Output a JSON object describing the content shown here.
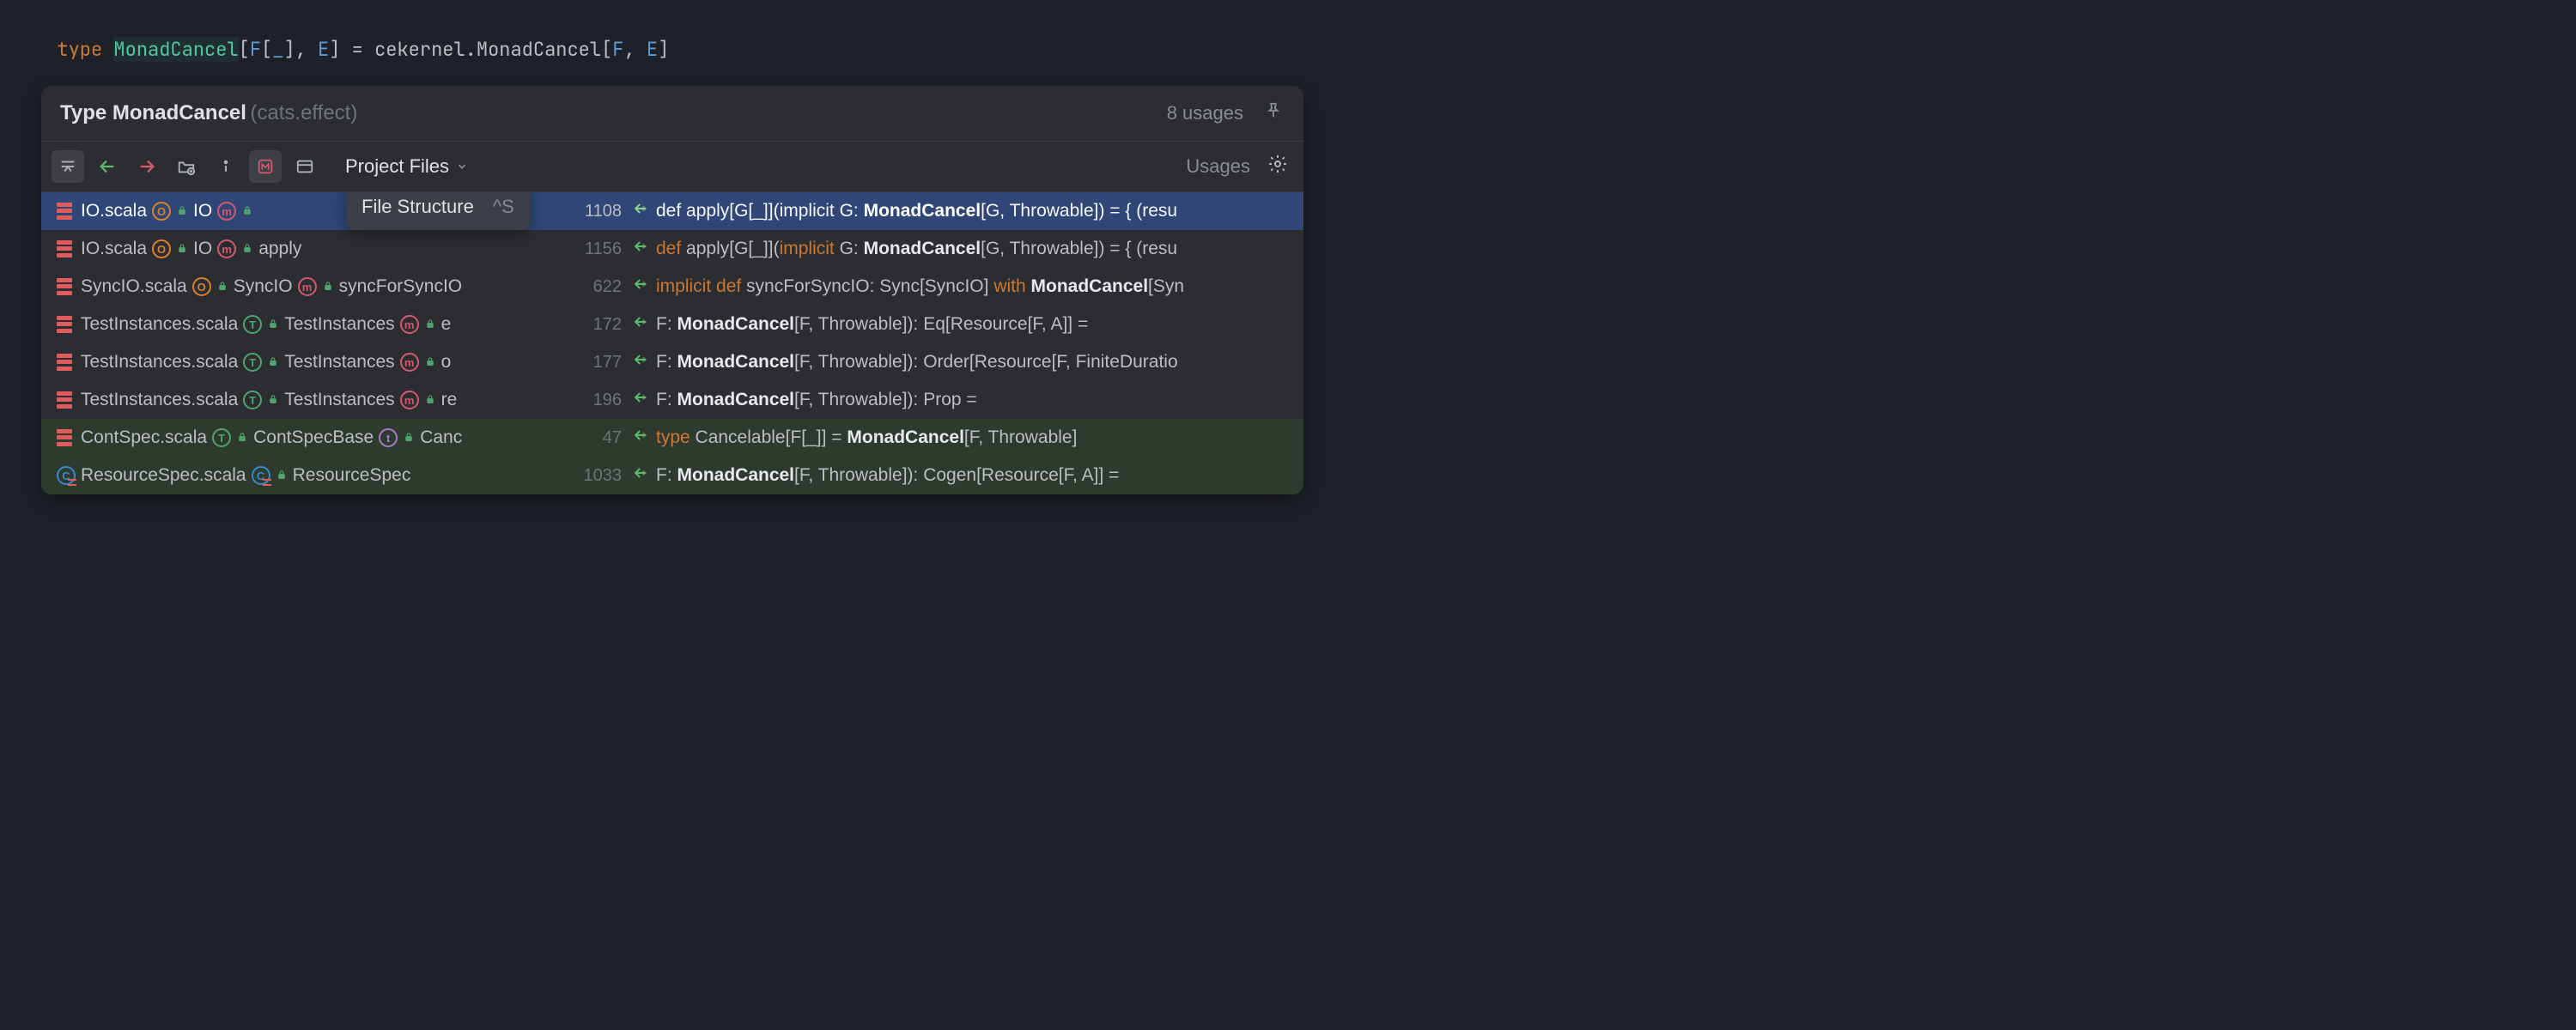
{
  "code": {
    "keyword": "type",
    "name": "MonadCancel",
    "sig_open": "[",
    "tp1": "F",
    "sig_mid1": "[",
    "tp_under": "_",
    "sig_mid2": "], ",
    "tp2": "E",
    "sig_close": "] = ",
    "rhs_pkg": "cekernel.MonadCancel[",
    "rhs_tp1": "F",
    "rhs_sep": ", ",
    "rhs_tp2": "E",
    "rhs_close": "]"
  },
  "popup": {
    "title": "Type MonadCancel",
    "subtitle": "(cats.effect)",
    "usages_count": "8 usages",
    "scope": "Project Files",
    "usages_label": "Usages",
    "tooltip": {
      "label": "File Structure",
      "shortcut": "^S"
    }
  },
  "rows": [
    {
      "file": "IO.scala",
      "badges": [
        {
          "kind": "ring",
          "letter": "O",
          "color": "#d9822b"
        },
        {
          "kind": "lock",
          "color": "#4fa36b"
        }
      ],
      "class": "IO",
      "badges2": [
        {
          "kind": "ring",
          "letter": "m",
          "color": "#d15a6f"
        },
        {
          "kind": "lock",
          "color": "#4fa36b"
        }
      ],
      "member": "",
      "line": "1108",
      "code_pre": "def apply[G[_]](implicit G: ",
      "code_bold": "MonadCancel",
      "code_post": "[G, Throwable]) = { (resu",
      "style": "selected"
    },
    {
      "file": "IO.scala",
      "badges": [
        {
          "kind": "ring",
          "letter": "O",
          "color": "#d9822b"
        },
        {
          "kind": "lock",
          "color": "#4fa36b"
        }
      ],
      "class": "IO",
      "badges2": [
        {
          "kind": "ring",
          "letter": "m",
          "color": "#d15a6f"
        },
        {
          "kind": "lock",
          "color": "#4fa36b"
        }
      ],
      "member": "apply",
      "line": "1156",
      "code_kw1": "def",
      "code_mid1": " apply[G[_]](",
      "code_kw2": "implicit",
      "code_mid2": " G: ",
      "code_bold": "MonadCancel",
      "code_post": "[G, Throwable]) = { (resu",
      "style": ""
    },
    {
      "file": "SyncIO.scala",
      "badges": [
        {
          "kind": "ring",
          "letter": "O",
          "color": "#d9822b"
        },
        {
          "kind": "lock",
          "color": "#4fa36b"
        }
      ],
      "class": "SyncIO",
      "badges2": [
        {
          "kind": "ring",
          "letter": "m",
          "color": "#d15a6f"
        },
        {
          "kind": "lock",
          "color": "#4fa36b"
        }
      ],
      "member": "syncForSyncIO",
      "line": "622",
      "code_kw1": "implicit",
      "code_mid1": " ",
      "code_kw2": "def",
      "code_mid2": " syncForSyncIO: Sync[SyncIO] ",
      "code_kw3": "with",
      "code_mid3": " ",
      "code_bold": "MonadCancel",
      "code_post": "[Syn",
      "style": ""
    },
    {
      "file": "TestInstances.scala",
      "badges": [
        {
          "kind": "ring",
          "letter": "T",
          "color": "#4fa36b"
        },
        {
          "kind": "lock",
          "color": "#4fa36b"
        }
      ],
      "class": "TestInstances",
      "badges2": [
        {
          "kind": "ring",
          "letter": "m",
          "color": "#d15a6f"
        },
        {
          "kind": "lock",
          "color": "#4fa36b"
        }
      ],
      "member": "e",
      "line": "172",
      "code_pre": "F: ",
      "code_bold": "MonadCancel",
      "code_post": "[F, Throwable]): Eq[Resource[F, A]] =",
      "style": ""
    },
    {
      "file": "TestInstances.scala",
      "badges": [
        {
          "kind": "ring",
          "letter": "T",
          "color": "#4fa36b"
        },
        {
          "kind": "lock",
          "color": "#4fa36b"
        }
      ],
      "class": "TestInstances",
      "badges2": [
        {
          "kind": "ring",
          "letter": "m",
          "color": "#d15a6f"
        },
        {
          "kind": "lock",
          "color": "#4fa36b"
        }
      ],
      "member": "o",
      "line": "177",
      "code_pre": "F: ",
      "code_bold": "MonadCancel",
      "code_post": "[F, Throwable]): Order[Resource[F, FiniteDuratio",
      "style": ""
    },
    {
      "file": "TestInstances.scala",
      "badges": [
        {
          "kind": "ring",
          "letter": "T",
          "color": "#4fa36b"
        },
        {
          "kind": "lock",
          "color": "#4fa36b"
        }
      ],
      "class": "TestInstances",
      "badges2": [
        {
          "kind": "ring",
          "letter": "m",
          "color": "#d15a6f"
        },
        {
          "kind": "lock",
          "color": "#4fa36b"
        }
      ],
      "member": "re",
      "line": "196",
      "code_pre": "F: ",
      "code_bold": "MonadCancel",
      "code_post": "[F, Throwable]): Prop =",
      "style": ""
    },
    {
      "file": "ContSpec.scala",
      "file_icon": "scala",
      "badges": [
        {
          "kind": "ring",
          "letter": "T",
          "color": "#4fa36b"
        },
        {
          "kind": "lock",
          "color": "#4fa36b"
        }
      ],
      "class": "ContSpecBase",
      "badges2": [
        {
          "kind": "ring",
          "letter": "t",
          "color": "#a77bc9"
        },
        {
          "kind": "lock",
          "color": "#4fa36b"
        }
      ],
      "member": "Canc",
      "line": "47",
      "code_kw1": "type",
      "code_mid1": " Cancelable[F[_]] = ",
      "code_bold": "MonadCancel",
      "code_post": "[F, Throwable]",
      "style": "green"
    },
    {
      "file": "ResourceSpec.scala",
      "file_icon": "class-c",
      "badges": [
        {
          "kind": "cicon",
          "letter": "C",
          "color": "#3b8ac9"
        },
        {
          "kind": "lock",
          "color": "#4fa36b"
        }
      ],
      "class": "ResourceSpec",
      "badges2": [],
      "member": "",
      "line": "1033",
      "code_pre": "F: ",
      "code_bold": "MonadCancel",
      "code_post": "[F, Throwable]): Cogen[Resource[F, A]] =",
      "style": "green"
    }
  ]
}
